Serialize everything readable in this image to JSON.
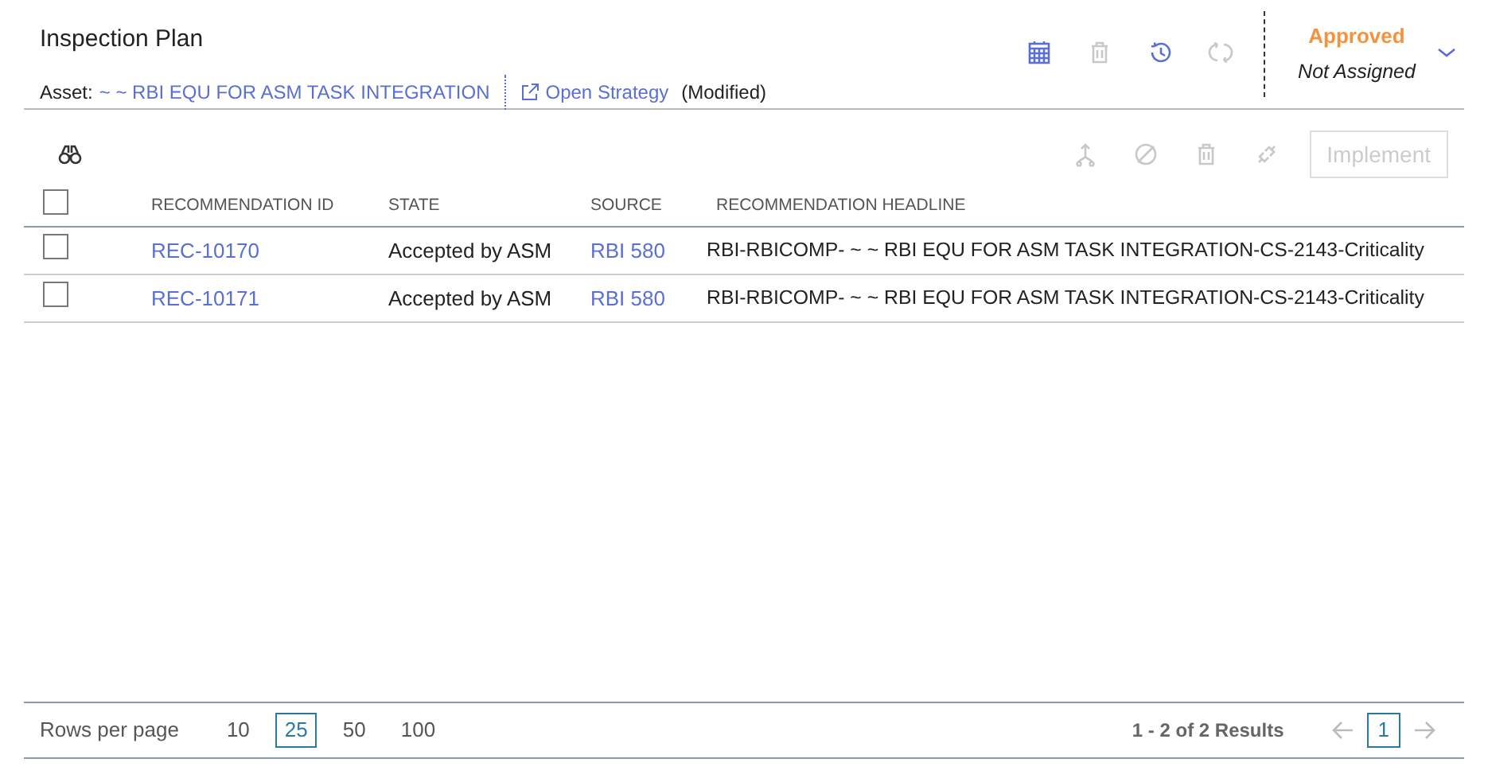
{
  "header": {
    "title": "Inspection Plan",
    "asset_label": "Asset:",
    "asset_link": "~ ~ RBI EQU FOR ASM TASK INTEGRATION",
    "open_strategy": "Open Strategy",
    "modified": "(Modified)",
    "state": "Approved",
    "assignee": "Not Assigned"
  },
  "header_actions": [
    {
      "kind": "calendar",
      "disabled": false
    },
    {
      "kind": "trash",
      "disabled": true
    },
    {
      "kind": "history",
      "disabled": false
    },
    {
      "kind": "sync",
      "disabled": true
    }
  ],
  "grid_actions": [
    {
      "kind": "branch",
      "disabled": true
    },
    {
      "kind": "cancel",
      "disabled": true
    },
    {
      "kind": "trash",
      "disabled": true
    },
    {
      "kind": "link",
      "disabled": true
    },
    {
      "kind": "button",
      "label": "Implement",
      "disabled": true
    }
  ],
  "table": {
    "select_all_checked": false,
    "columns": [
      "RECOMMENDATION ID",
      "STATE",
      "SOURCE",
      "RECOMMENDATION HEADLINE"
    ],
    "rows": [
      {
        "checked": false,
        "id": "REC-10170",
        "state": "Accepted by ASM",
        "source": "RBI 580",
        "headline": "RBI-RBICOMP- ~ ~ RBI EQU FOR ASM TASK INTEGRATION-CS-2143-Criticality"
      },
      {
        "checked": false,
        "id": "REC-10171",
        "state": "Accepted by ASM",
        "source": "RBI 580",
        "headline": "RBI-RBICOMP- ~ ~ RBI EQU FOR ASM TASK INTEGRATION-CS-2143-Criticality"
      }
    ]
  },
  "footer": {
    "rows_per_page_label": "Rows per page",
    "page_sizes": [
      {
        "label": "10",
        "selected": false
      },
      {
        "label": "25",
        "selected": true
      },
      {
        "label": "50",
        "selected": false
      },
      {
        "label": "100",
        "selected": false
      }
    ],
    "results": "1 - 2 of 2 Results",
    "pages": [
      {
        "label": "1",
        "selected": true
      }
    ]
  }
}
